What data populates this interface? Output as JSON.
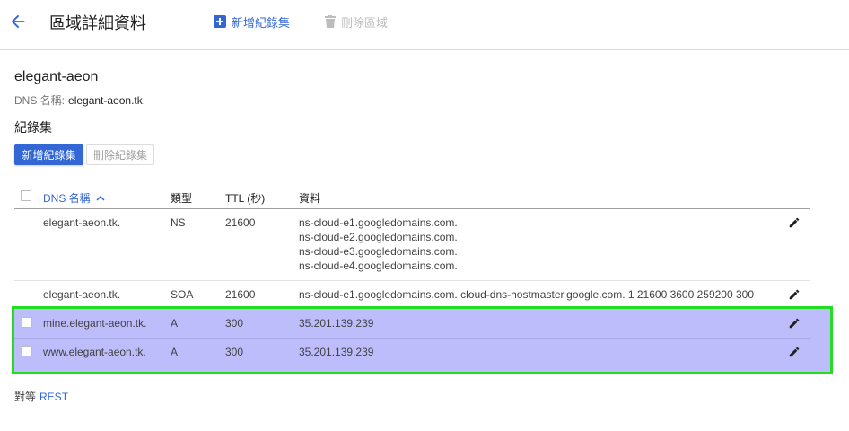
{
  "header": {
    "title": "區域詳細資料",
    "add_record_set": "新增紀錄集",
    "delete_zone": "刪除區域"
  },
  "zone": {
    "name": "elegant-aeon",
    "dns_name_label": "DNS 名稱:",
    "dns_name": "elegant-aeon.tk."
  },
  "records_section": {
    "title": "紀錄集",
    "add_button": "新增紀錄集",
    "delete_button": "刪除紀錄集"
  },
  "table": {
    "columns": {
      "dns_name": "DNS 名稱",
      "type": "類型",
      "ttl": "TTL (秒)",
      "data": "資料"
    },
    "rows": [
      {
        "dns_name": "elegant-aeon.tk.",
        "type": "NS",
        "ttl": "21600",
        "data": [
          "ns-cloud-e1.googledomains.com.",
          "ns-cloud-e2.googledomains.com.",
          "ns-cloud-e3.googledomains.com.",
          "ns-cloud-e4.googledomains.com."
        ]
      },
      {
        "dns_name": "elegant-aeon.tk.",
        "type": "SOA",
        "ttl": "21600",
        "data": [
          "ns-cloud-e1.googledomains.com. cloud-dns-hostmaster.google.com. 1 21600 3600 259200 300"
        ]
      },
      {
        "dns_name": "mine.elegant-aeon.tk.",
        "type": "A",
        "ttl": "300",
        "data": [
          "35.201.139.239"
        ]
      },
      {
        "dns_name": "www.elegant-aeon.tk.",
        "type": "A",
        "ttl": "300",
        "data": [
          "35.201.139.239"
        ]
      }
    ]
  },
  "footer": {
    "prefix": "對等",
    "link": "REST"
  },
  "colors": {
    "accent": "#3367d6",
    "highlight_fill": "#bdbdfc",
    "highlight_border": "#22dd22"
  }
}
